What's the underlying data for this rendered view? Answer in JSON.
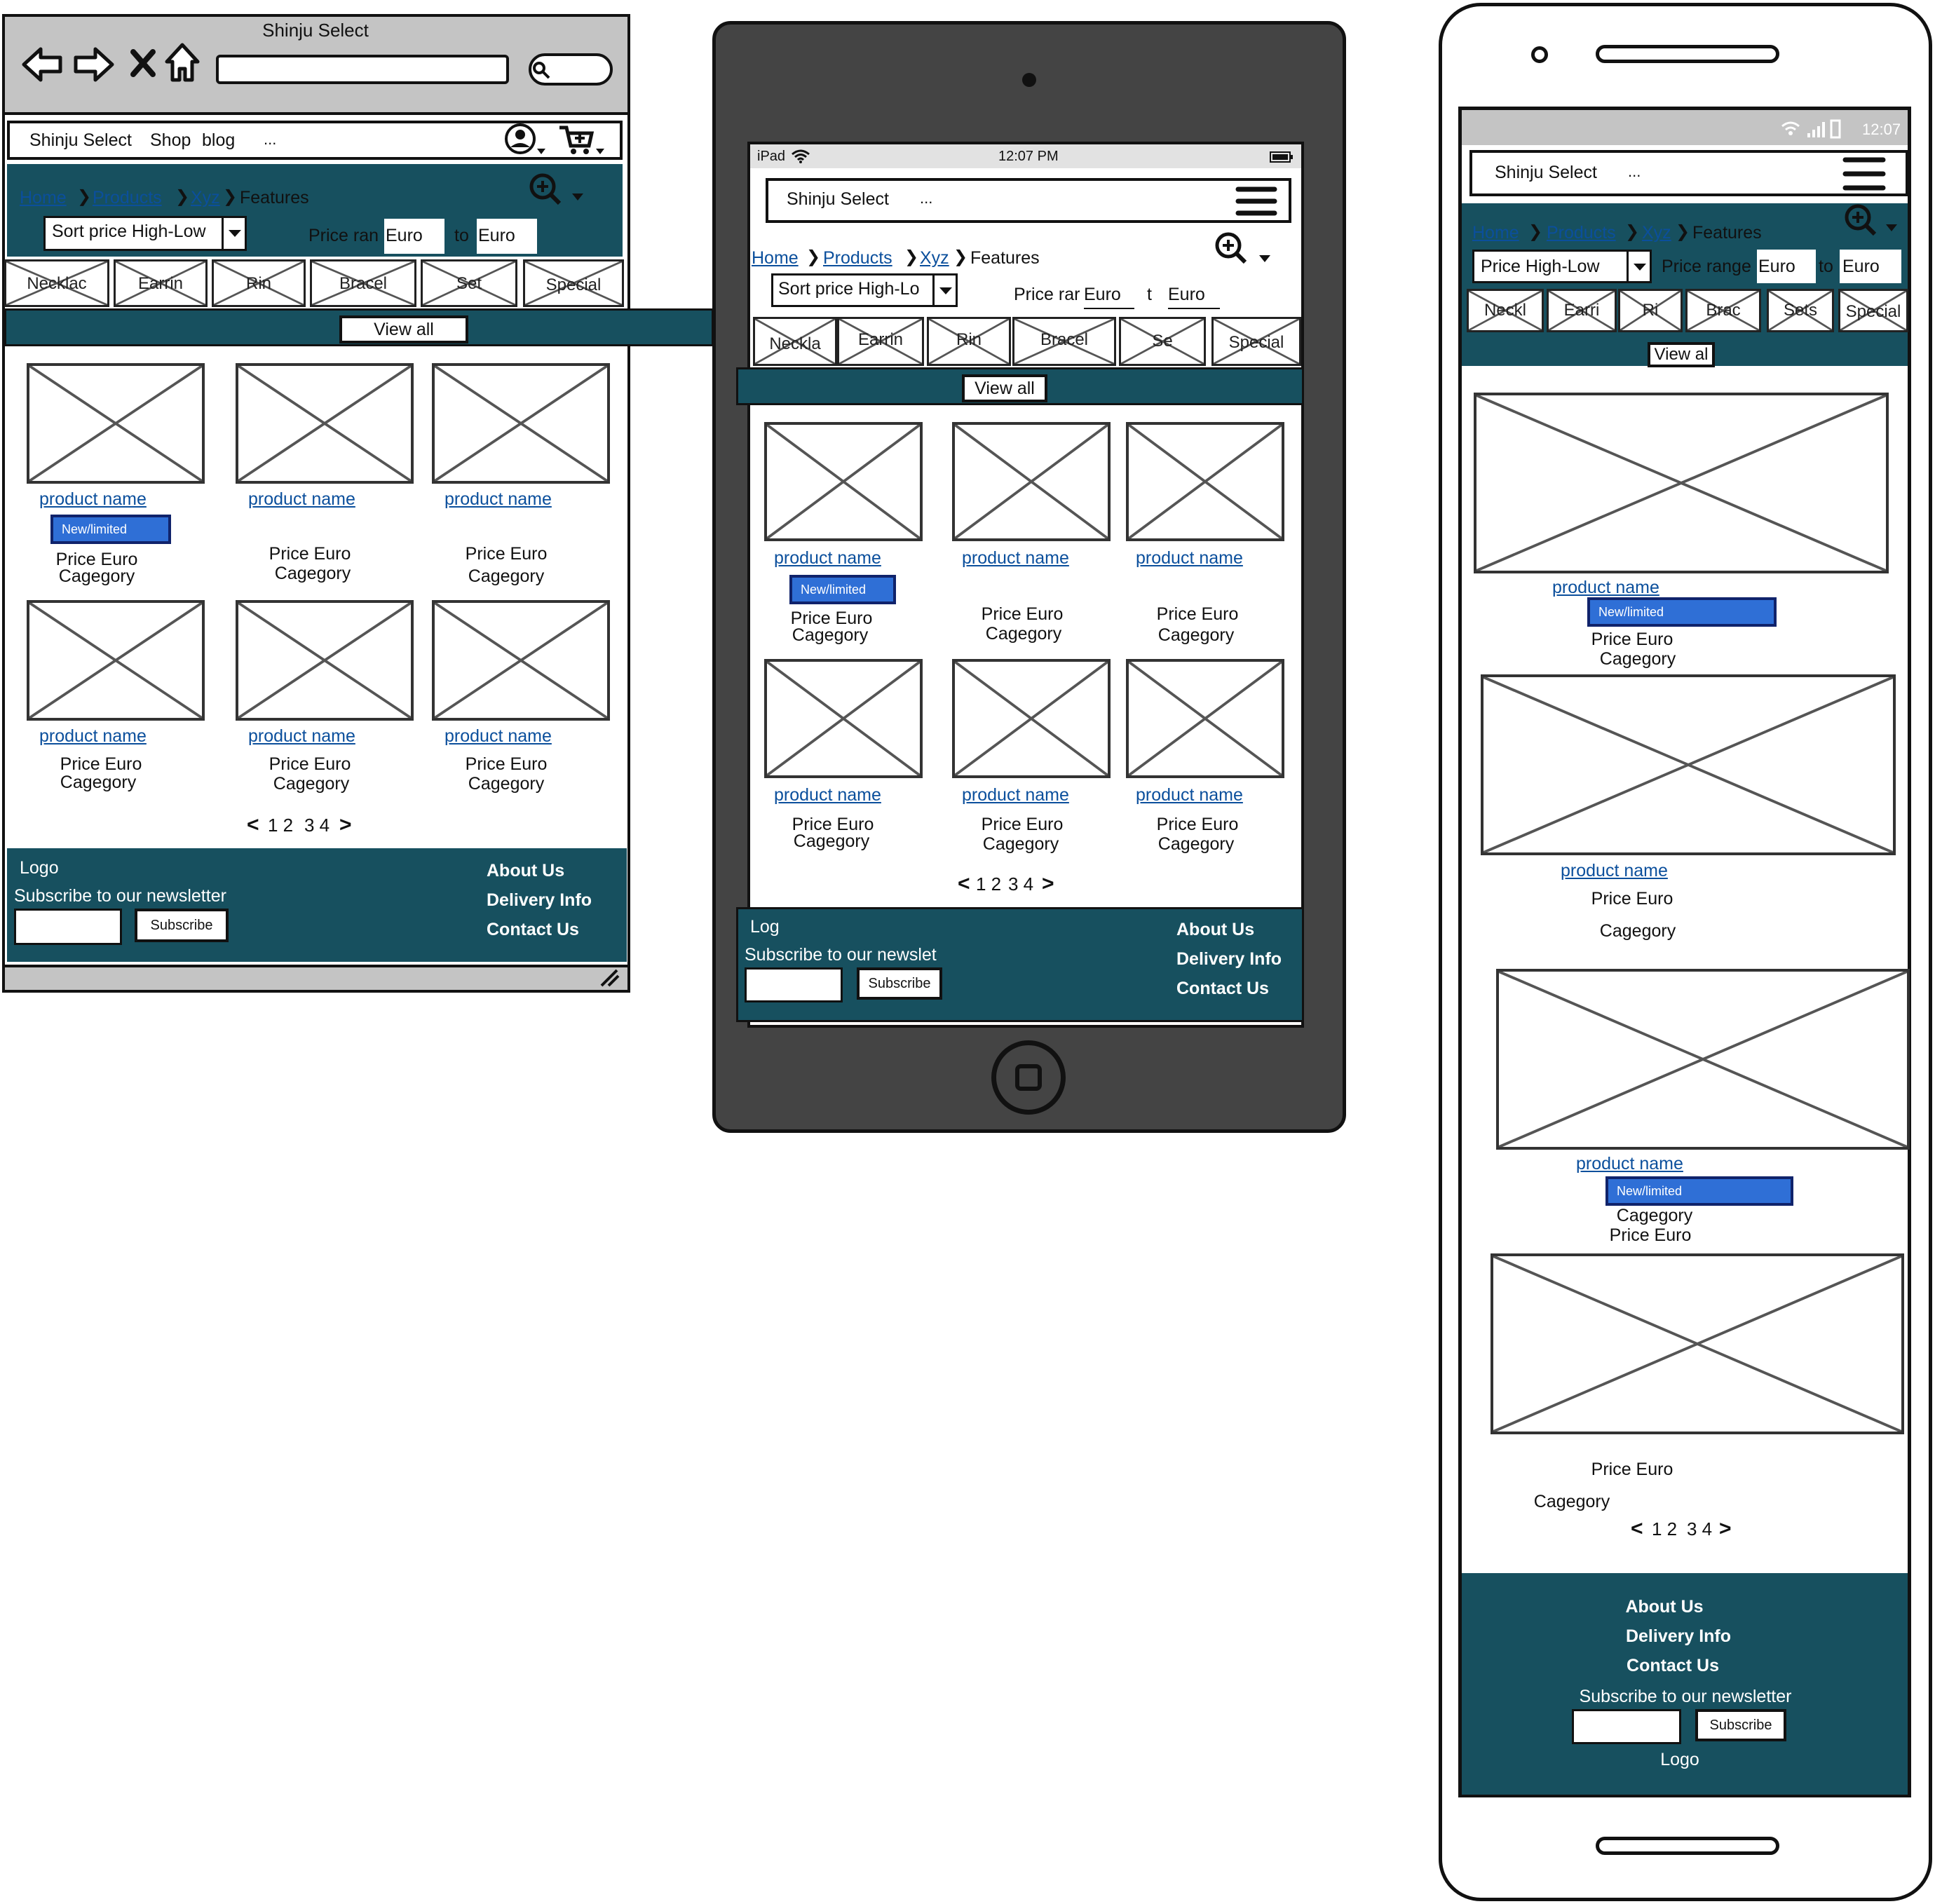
{
  "desktop": {
    "window_title": "Shinju Select",
    "nav": {
      "brand": "Shinju Select",
      "links": [
        "Shop",
        "blog"
      ],
      "more": "..."
    },
    "breadcrumb": [
      "Home",
      "Products",
      "Xyz",
      "Features"
    ],
    "sort_label": "Sort price High-Low",
    "price_range_label": "Price ran",
    "price_from": "Euro",
    "price_to_label": "to",
    "price_to": "Euro",
    "categories": [
      "Necklac",
      "Earrin",
      "Rin",
      "Bracel",
      "Set",
      "Special"
    ],
    "view_all": "View all",
    "products": [
      {
        "name": "product name",
        "badge": "New/limited",
        "price": "Price Euro",
        "category": "Cagegory"
      },
      {
        "name": "product name",
        "price": "Price Euro",
        "category": "Cagegory"
      },
      {
        "name": "product name",
        "price": "Price Euro",
        "category": "Cagegory"
      },
      {
        "name": "product name",
        "price": "Price Euro",
        "category": "Cagegory"
      },
      {
        "name": "product name",
        "price": "Price Euro",
        "category": "Cagegory"
      },
      {
        "name": "product name",
        "price": "Price Euro",
        "category": "Cagegory"
      }
    ],
    "pagination": {
      "prev": "<",
      "pages_a": "1 2",
      "pages_b": "3 4",
      "next": ">"
    },
    "footer": {
      "logo": "Logo",
      "newsletter": "Subscribe to our newsletter",
      "subscribe": "Subscribe",
      "links": [
        "About Us",
        "Delivery Info",
        "Contact Us"
      ]
    }
  },
  "tablet": {
    "status": {
      "device": "iPad",
      "time": "12:07 PM"
    },
    "nav": {
      "brand": "Shinju Select",
      "more": "..."
    },
    "breadcrumb": [
      "Home",
      "Products",
      "Xyz",
      "Features"
    ],
    "sort_label": "Sort price High-Lo",
    "price_range_label": "Price rar",
    "price_from": "Euro",
    "price_to_label": "t",
    "price_to": "Euro",
    "categories": [
      "Neckla",
      "Earrin",
      "Rin",
      "Bracel",
      "Se",
      "Special"
    ],
    "view_all": "View all",
    "products": [
      {
        "name": "product name",
        "badge": "New/limited",
        "price": "Price Euro",
        "category": "Cagegory"
      },
      {
        "name": "product name",
        "price": "Price Euro",
        "category": "Cagegory"
      },
      {
        "name": "product name",
        "price": "Price Euro",
        "category": "Cagegory"
      },
      {
        "name": "product name",
        "price": "Price Euro",
        "category": "Cagegory"
      },
      {
        "name": "product name",
        "price": "Price Euro",
        "category": "Cagegory"
      },
      {
        "name": "product name",
        "price": "Price Euro",
        "category": "Cagegory"
      }
    ],
    "pagination": {
      "prev": "<",
      "pages_a": "1 2",
      "pages_b": "3 4",
      "next": ">"
    },
    "footer": {
      "logo": "Log",
      "newsletter": "Subscribe to our newslet",
      "subscribe": "Subscribe",
      "links": [
        "About Us",
        "Delivery Info",
        "Contact Us"
      ]
    }
  },
  "mobile": {
    "status": {
      "time": "12:07"
    },
    "nav": {
      "brand": "Shinju Select",
      "more": "..."
    },
    "breadcrumb": [
      "Home",
      "Products",
      "Xyz",
      "Features"
    ],
    "sort_label": "Price High-Low",
    "price_range_label": "Price range",
    "price_from": "Euro",
    "price_to_label": "to",
    "price_to": "Euro",
    "categories": [
      "Neckl",
      "Earri",
      "Ri",
      "Brac",
      "Sets",
      "Special"
    ],
    "view_all": "View al",
    "products": [
      {
        "name": "product name",
        "badge": "New/limited",
        "price": "Price Euro",
        "category": "Cagegory"
      },
      {
        "name": "product name",
        "price": "Price Euro",
        "category": "Cagegory"
      },
      {
        "name": "product name",
        "badge": "New/limited",
        "category": "Cagegory",
        "price": "Price Euro"
      },
      {
        "price": "Price Euro",
        "category": "Cagegory"
      }
    ],
    "pagination": {
      "prev": "<",
      "pages_a": "1 2",
      "pages_b": "3 4",
      "next": ">"
    },
    "footer": {
      "links": [
        "About Us",
        "Delivery Info",
        "Contact Us"
      ],
      "newsletter": "Subscribe to our newsletter",
      "subscribe": "Subscribe",
      "logo": "Logo"
    }
  },
  "colors": {
    "teal": "#17505f",
    "link": "#0b4f9c",
    "badge": "#2f6fd6",
    "device_dark": "#444444",
    "chrome_gray": "#c4c4c4"
  },
  "icons": [
    "back-arrow-icon",
    "forward-arrow-icon",
    "close-icon",
    "home-icon",
    "search-icon",
    "user-icon",
    "cart-icon",
    "zoom-in-icon",
    "chevron-down-icon",
    "wifi-icon",
    "battery-icon",
    "signal-icon",
    "hamburger-icon",
    "chevron-left-icon",
    "chevron-right-icon",
    "resize-grip-icon",
    "home-button-icon"
  ]
}
